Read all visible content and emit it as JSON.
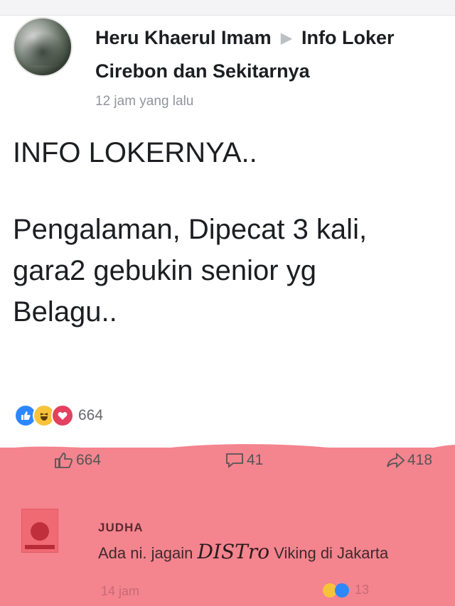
{
  "post": {
    "author": "Heru Khaerul Imam",
    "group_line1": "Info Loker",
    "group_line2": "Cirebon dan Sekitarnya",
    "timestamp": "12 jam yang lalu",
    "text_lines": [
      "INFO LOKERNYA..",
      "Pengalaman, Dipecat 3 kali,",
      "gara2 gebukin senior yg",
      "Belagu.."
    ],
    "reaction_count": "664"
  },
  "actions": {
    "like_count": "664",
    "comment_count": "41",
    "share_count": "418"
  },
  "comment": {
    "name": "JUDHA",
    "text_prefix": "Ada ni. jagain",
    "text_script": "DISTro",
    "text_suffix": "Viking di Jakarta",
    "time": "14 jam",
    "reaction_count": "13"
  },
  "colors": {
    "like_blue": "#2d88ff",
    "haha_yellow": "#f7c33b",
    "love_red": "#e4405f",
    "overlay_pink": "#f4848e"
  },
  "icons": [
    "avatar",
    "arrow-right-icon",
    "like-reaction-icon",
    "haha-reaction-icon",
    "love-reaction-icon",
    "thumbs-up-icon",
    "comment-icon",
    "share-icon"
  ]
}
